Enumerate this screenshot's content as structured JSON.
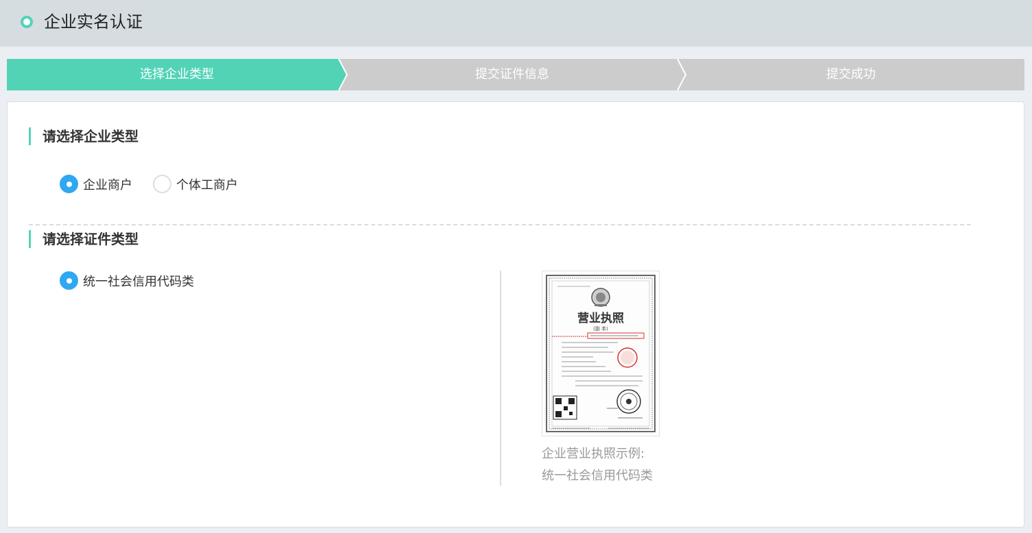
{
  "header": {
    "title": "企业实名认证"
  },
  "steps": [
    "选择企业类型",
    "提交证件信息",
    "提交成功"
  ],
  "company_type": {
    "heading": "请选择企业类型",
    "options": [
      {
        "label": "企业商户",
        "selected": true
      },
      {
        "label": "个体工商户",
        "selected": false
      }
    ]
  },
  "certificate_type": {
    "heading": "请选择证件类型",
    "options": [
      {
        "label": "统一社会信用代码类",
        "selected": true
      }
    ]
  },
  "sample": {
    "license_title": "营业执照",
    "license_subtitle": "(副 本)",
    "caption_line1": "企业营业执照示例:",
    "caption_line2": "统一社会信用代码类"
  },
  "colors": {
    "accent": "#52d3b6",
    "radio_active": "#2fa8f2",
    "step_inactive": "#cccccc",
    "stamp_red": "#d9302b"
  }
}
